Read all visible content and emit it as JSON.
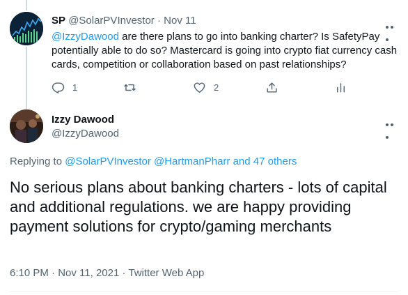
{
  "reply_tweet": {
    "name": "SP",
    "handle": "@SolarPVInvestor",
    "separator": "·",
    "date": "Nov 11",
    "mention": "@IzzyDawood",
    "text": " are there plans to go into banking charter? Is SafetyPay potentially able to do so? Mastercard is going into crypto fiat currency cash cards, competition or collaboration based on past relationships?",
    "actions": {
      "reply_count": "1",
      "retweet_count": "",
      "like_count": "2"
    }
  },
  "main_tweet": {
    "name": "Izzy Dawood",
    "handle": "@IzzyDawood",
    "replying_prefix": "Replying to ",
    "replying_to": "@SolarPVInvestor @HartmanPharr and 47 others",
    "text": "No serious plans about banking charters - lots of capital and additional regulations.  we are happy providing payment solutions for crypto/gaming merchants",
    "meta": "6:10 PM · Nov 11, 2021 · Twitter Web App"
  },
  "colors": {
    "text": "#0f1419",
    "secondary": "#536471",
    "link": "#1d9bf0",
    "thread_line": "#cfd9de"
  },
  "icons": [
    "reply-icon",
    "retweet-icon",
    "like-icon",
    "share-icon",
    "analytics-icon",
    "more-icon"
  ]
}
